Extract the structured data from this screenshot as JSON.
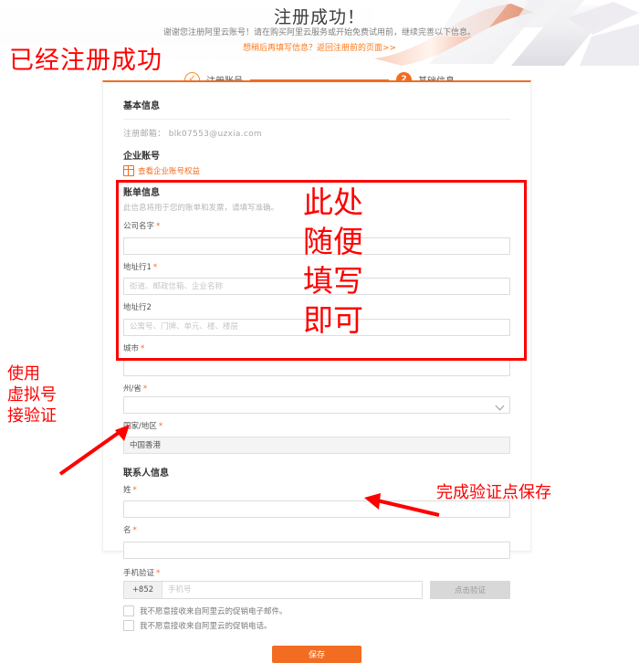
{
  "banner": {
    "title": "注册成功！",
    "subtitle": "谢谢您注册阿里云账号！请在购买阿里云服务或开始免费试用前，继续完善以下信息。",
    "link": "想稍后再填写信息？返回注册前的页面>>"
  },
  "steps": [
    {
      "label": "注册账号",
      "marker": "✓",
      "state": "done"
    },
    {
      "label": "基础信息",
      "marker": "2",
      "state": "current"
    }
  ],
  "basic": {
    "section_title": "基本信息",
    "email_label": "注册邮箱：",
    "email_value": "blk07553@uzxia.com",
    "enterprise_title": "企业账号",
    "enterprise_link": "查看企业账号权益"
  },
  "billing": {
    "section_title": "账单信息",
    "section_sub": "此信息将用于您的账单和发票，请填写准确。",
    "fields": [
      {
        "label": "公司名字",
        "required": true,
        "value": "",
        "placeholder": ""
      },
      {
        "label": "地址行1",
        "required": true,
        "value": "",
        "placeholder": "街道、邮政信箱、企业名称"
      },
      {
        "label": "地址行2",
        "required": false,
        "value": "",
        "placeholder": "公寓号、门牌、单元、楼、楼层"
      },
      {
        "label": "城市",
        "required": true,
        "value": "",
        "placeholder": ""
      },
      {
        "label": "州/省",
        "required": true,
        "value": "",
        "placeholder": ""
      }
    ],
    "country_label": "国家/地区",
    "country_required": true,
    "country_value": "中国香港"
  },
  "contact": {
    "section_title": "联系人信息",
    "last_name_label": "姓",
    "last_name_value": "",
    "first_name_label": "名",
    "first_name_value": "",
    "phone_label": "手机验证",
    "phone_code": "+852",
    "phone_placeholder": "手机号",
    "phone_value": "",
    "verify_button": "点击验证"
  },
  "consent": {
    "email_opt_out": "我不愿意接收来自阿里云的促销电子邮件。",
    "phone_opt_out": "我不愿意接收来自阿里云的促销电话。"
  },
  "actions": {
    "save_button": "保存"
  },
  "annotations": {
    "registered_success": "已经注册成功",
    "fill_anything": "此处\n随便\n填写\n即可",
    "fill_anything_lines": [
      "此处",
      "随便",
      "填写",
      "即可"
    ],
    "use_virtual_number": [
      "使用",
      "虚拟号",
      "接验证"
    ],
    "finish_verify_save": "完成验证点保存"
  },
  "colors": {
    "accent_orange": "#f26c21",
    "annotation_red": "#ff0000",
    "text_gray": "#666666"
  }
}
